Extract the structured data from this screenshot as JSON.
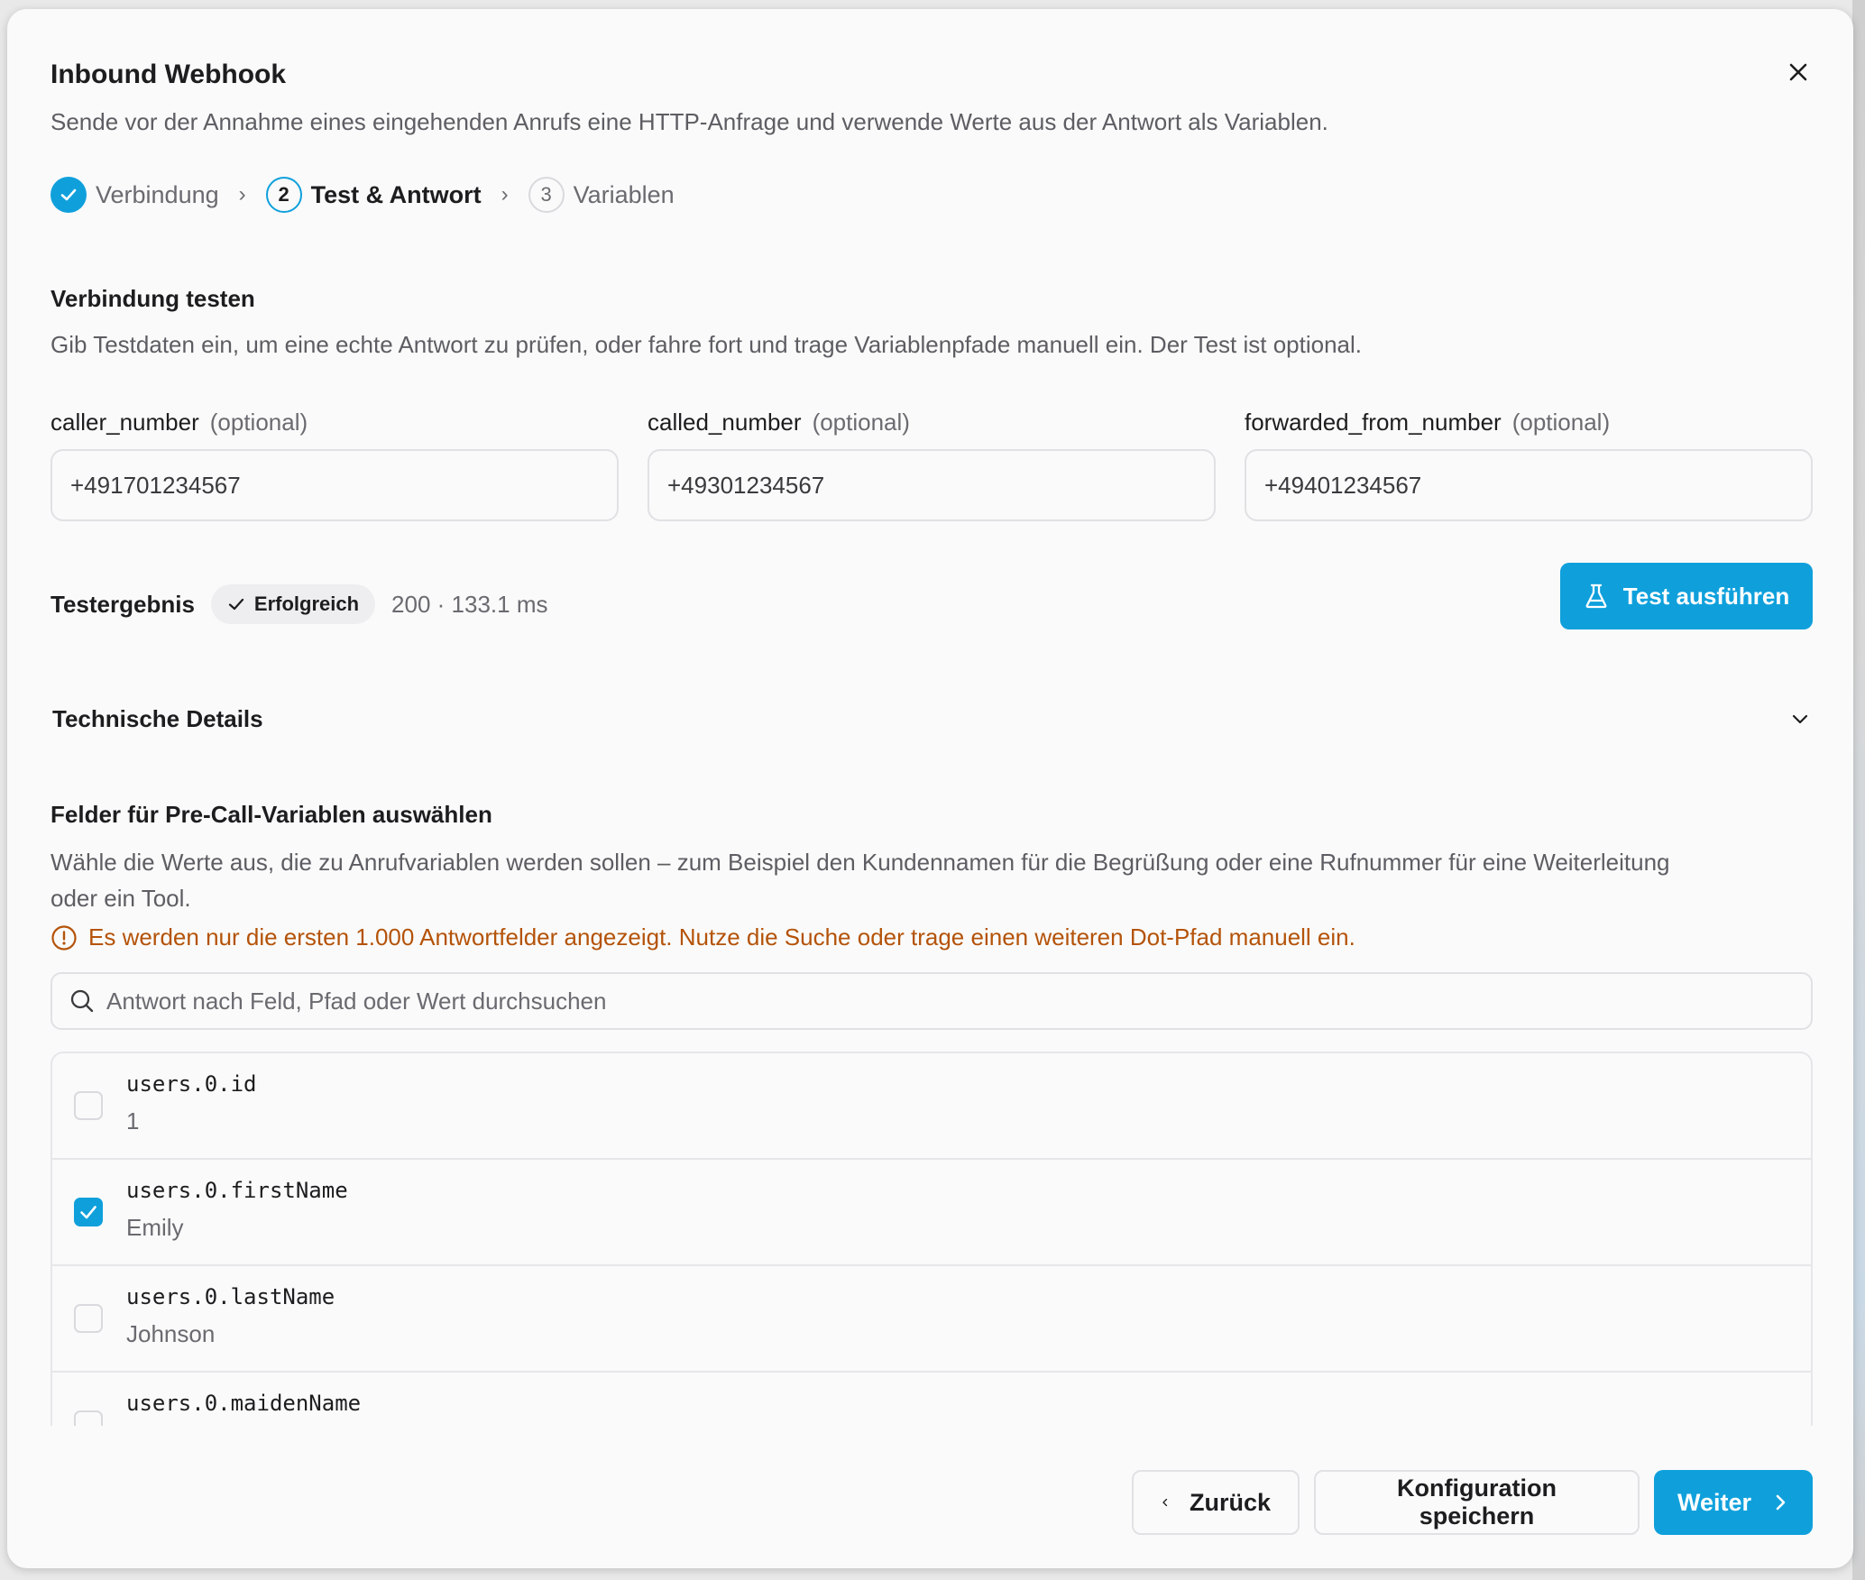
{
  "dialog": {
    "title": "Inbound Webhook",
    "subtitle": "Sende vor der Annahme eines eingehenden Anrufs eine HTTP-Anfrage und verwende Werte aus der Antwort als Variablen."
  },
  "steps": [
    {
      "number": "1",
      "label": "Verbindung",
      "state": "done"
    },
    {
      "number": "2",
      "label": "Test & Antwort",
      "state": "active"
    },
    {
      "number": "3",
      "label": "Variablen",
      "state": "todo"
    }
  ],
  "test_section": {
    "heading": "Verbindung testen",
    "description": "Gib Testdaten ein, um eine echte Antwort zu prüfen, oder fahre fort und trage Variablenpfade manuell ein. Der Test ist optional.",
    "fields": [
      {
        "name": "caller_number",
        "optional": "(optional)",
        "value": "+491701234567"
      },
      {
        "name": "called_number",
        "optional": "(optional)",
        "value": "+49301234567"
      },
      {
        "name": "forwarded_from_number",
        "optional": "(optional)",
        "value": "+49401234567"
      }
    ],
    "result_label": "Testergebnis",
    "result_badge": "Erfolgreich",
    "result_meta": "200 · 133.1 ms",
    "run_button": "Test ausführen"
  },
  "technical_details": {
    "label": "Technische Details"
  },
  "variables_section": {
    "heading": "Felder für Pre-Call-Variablen auswählen",
    "description_line1": "Wähle die Werte aus, die zu Anrufvariablen werden sollen – zum Beispiel den Kundennamen für die Begrüßung oder eine Rufnummer für eine Weiterleitung",
    "description_line2": "oder ein Tool.",
    "warning": "Es werden nur die ersten 1.000 Antwortfelder angezeigt. Nutze die Suche oder trage einen weiteren Dot-Pfad manuell ein.",
    "search_placeholder": "Antwort nach Feld, Pfad oder Wert durchsuchen",
    "items": [
      {
        "path": "users.0.id",
        "value": "1",
        "checked": false
      },
      {
        "path": "users.0.firstName",
        "value": "Emily",
        "checked": true
      },
      {
        "path": "users.0.lastName",
        "value": "Johnson",
        "checked": false
      },
      {
        "path": "users.0.maidenName",
        "value": "",
        "checked": false
      }
    ]
  },
  "footer": {
    "back_label": "Zurück",
    "save_label": "Konfiguration speichern",
    "next_label": "Weiter"
  },
  "colors": {
    "accent": "#0fa0dc",
    "warning": "#b45309"
  }
}
